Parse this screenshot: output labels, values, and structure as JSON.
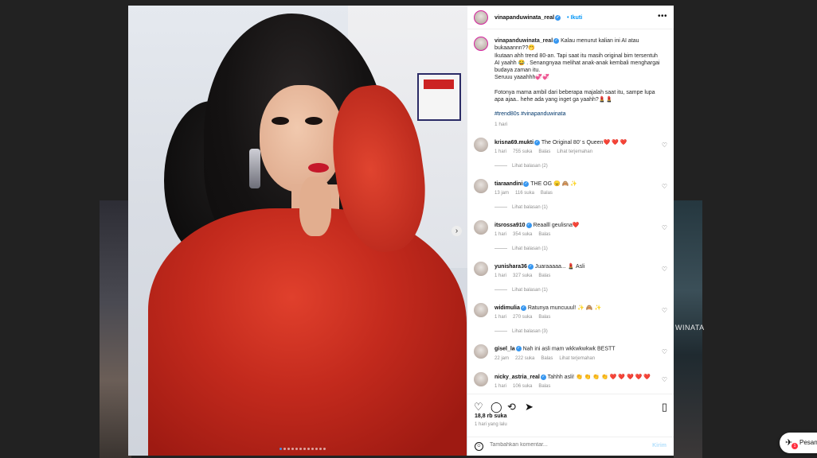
{
  "post": {
    "username": "vinapanduwinata_real",
    "follow_label": "Ikuti",
    "more_label": "•••",
    "caption_lines": [
      "Kalau menurut kalian ini AI atau bukaaannn??🤭",
      "Ikutaan ahh trend 80-an. Tapi saat itu masih original bim tersentuh AI yaahh 😂 . Senangnyaa melihat anak-anak kembali menghargai budaya zaman itu.",
      "Seruuu yaaahhh💞💞",
      "Fotonya mama ambil dari beberapa majalah saat itu, sampe lupa apa ajaa.. hehe ada yang inget ga yaahh?💄💄"
    ],
    "hashtags": "#trend80s #vinapanduwinata",
    "caption_time": "1 hari"
  },
  "comments": [
    {
      "user": "krisna69.mukti",
      "text": "The Original 80' s Queen❤️ ❤️ ❤️",
      "time": "1 hari",
      "likes": "755 suka",
      "reply": "Balas",
      "translate": "Lihat terjemahan",
      "replies": "Lihat balasan (2)"
    },
    {
      "user": "tiaraandini",
      "text": "THE OG 😠 🙈 ✨",
      "time": "13 jam",
      "likes": "116 suka",
      "reply": "Balas",
      "translate": "",
      "replies": "Lihat balasan (1)"
    },
    {
      "user": "itsrossa910",
      "text": "Reaalll geulisna❤️",
      "time": "1 hari",
      "likes": "354 suka",
      "reply": "Balas",
      "translate": "",
      "replies": "Lihat balasan (1)"
    },
    {
      "user": "yunishara36",
      "text": "Juaraaaaa... 💄 Asli",
      "time": "1 hari",
      "likes": "327 suka",
      "reply": "Balas",
      "translate": "",
      "replies": "Lihat balasan (1)"
    },
    {
      "user": "widimulia",
      "text": "Ratunya muncuuul! ✨ 🙈 ✨",
      "time": "1 hari",
      "likes": "270 suka",
      "reply": "Balas",
      "translate": "",
      "replies": "Lihat balasan (3)"
    },
    {
      "user": "gisel_la",
      "text": "Nah ini asli mam wkkwkwkwk BESTT",
      "time": "22 jam",
      "likes": "222 suka",
      "reply": "Balas",
      "translate": "Lihat terjemahan",
      "replies": ""
    },
    {
      "user": "nicky_astria_real",
      "text": "Tahhh asli! 👏 👏 👏 👏 ❤️ ❤️ ❤️ ❤️ ❤️",
      "time": "1 hari",
      "likes": "106 suka",
      "reply": "Balas",
      "translate": "",
      "replies": ""
    }
  ],
  "footer": {
    "likes": "18,8 rb suka",
    "posted": "1 hari yang lalu",
    "comment_placeholder": "Tambahkan komentar...",
    "send_label": "Kirim"
  },
  "background": {
    "right_text": "WINATA"
  },
  "messages": {
    "label": "Pesan",
    "badge": "1"
  },
  "icons": {
    "heart": "heart-icon",
    "comment": "comment-icon",
    "share": "share-icon",
    "save": "save-icon",
    "emoji": "emoji-icon"
  },
  "colors": {
    "accent": "#0095f6",
    "verified": "#3797f0",
    "jacket": "#c32a1d"
  }
}
